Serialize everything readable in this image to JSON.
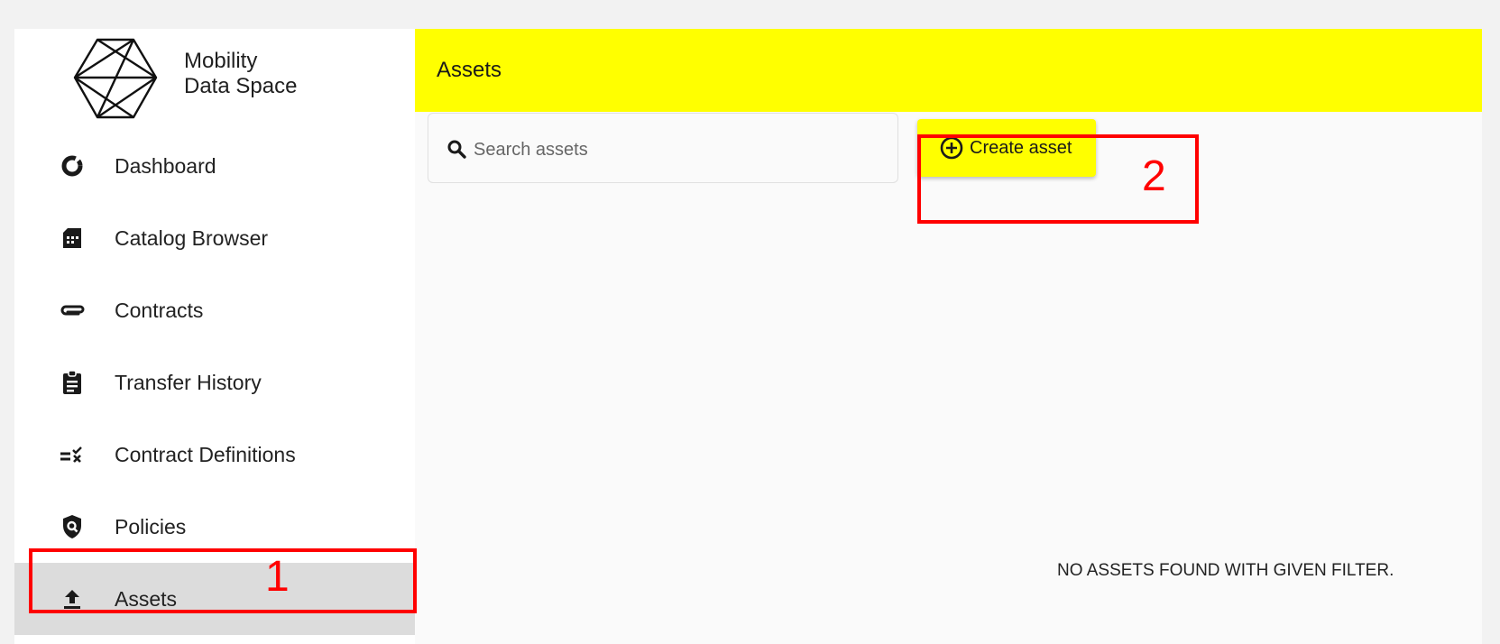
{
  "brand": {
    "line1": "Mobility",
    "line2": "Data Space"
  },
  "sidebar": {
    "items": [
      {
        "label": "Dashboard",
        "icon": "donut-chart-icon"
      },
      {
        "label": "Catalog Browser",
        "icon": "catalog-icon"
      },
      {
        "label": "Contracts",
        "icon": "paperclip-icon"
      },
      {
        "label": "Transfer History",
        "icon": "clipboard-icon"
      },
      {
        "label": "Contract Definitions",
        "icon": "rule-icon"
      },
      {
        "label": "Policies",
        "icon": "policy-shield-icon"
      },
      {
        "label": "Assets",
        "icon": "upload-icon",
        "active": true
      }
    ]
  },
  "header": {
    "title": "Assets"
  },
  "search": {
    "placeholder": "Search assets",
    "value": ""
  },
  "toolbar": {
    "create_label": "Create asset"
  },
  "empty_state": "NO ASSETS FOUND WITH GIVEN FILTER.",
  "annotations": [
    {
      "label": "1",
      "color": "#ff0000"
    },
    {
      "label": "2",
      "color": "#ff0000"
    }
  ],
  "colors": {
    "accent": "#ffff00",
    "annotation": "#ff0000",
    "active_bg": "#dcdcdc"
  }
}
